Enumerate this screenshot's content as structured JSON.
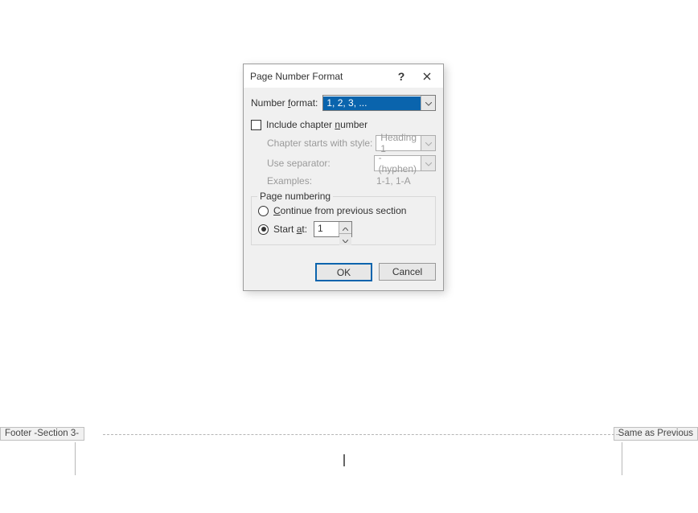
{
  "dialog": {
    "title": "Page Number Format",
    "help_symbol": "?",
    "number_format": {
      "label_pre": "Number ",
      "label_underlined": "f",
      "label_post": "ormat:",
      "selected": "1, 2, 3, ..."
    },
    "include_chapter": {
      "pre": "Include chapter ",
      "under": "n",
      "post": "umber",
      "chapter_style_label": "Chapter starts with style:",
      "chapter_style_value": "Heading 1",
      "separator_label": "Use separator:",
      "separator_value": "-   (hyphen)",
      "examples_label": "Examples:",
      "examples_value": "1-1, 1-A"
    },
    "page_numbering": {
      "legend": "Page numbering",
      "continue_under": "C",
      "continue_post": "ontinue from previous section",
      "start_pre": "Start ",
      "start_under": "a",
      "start_post": "t:",
      "start_value": "1"
    },
    "ok": "OK",
    "cancel": "Cancel"
  },
  "footer": {
    "left": "Footer -Section 3-",
    "right": "Same as Previous"
  }
}
